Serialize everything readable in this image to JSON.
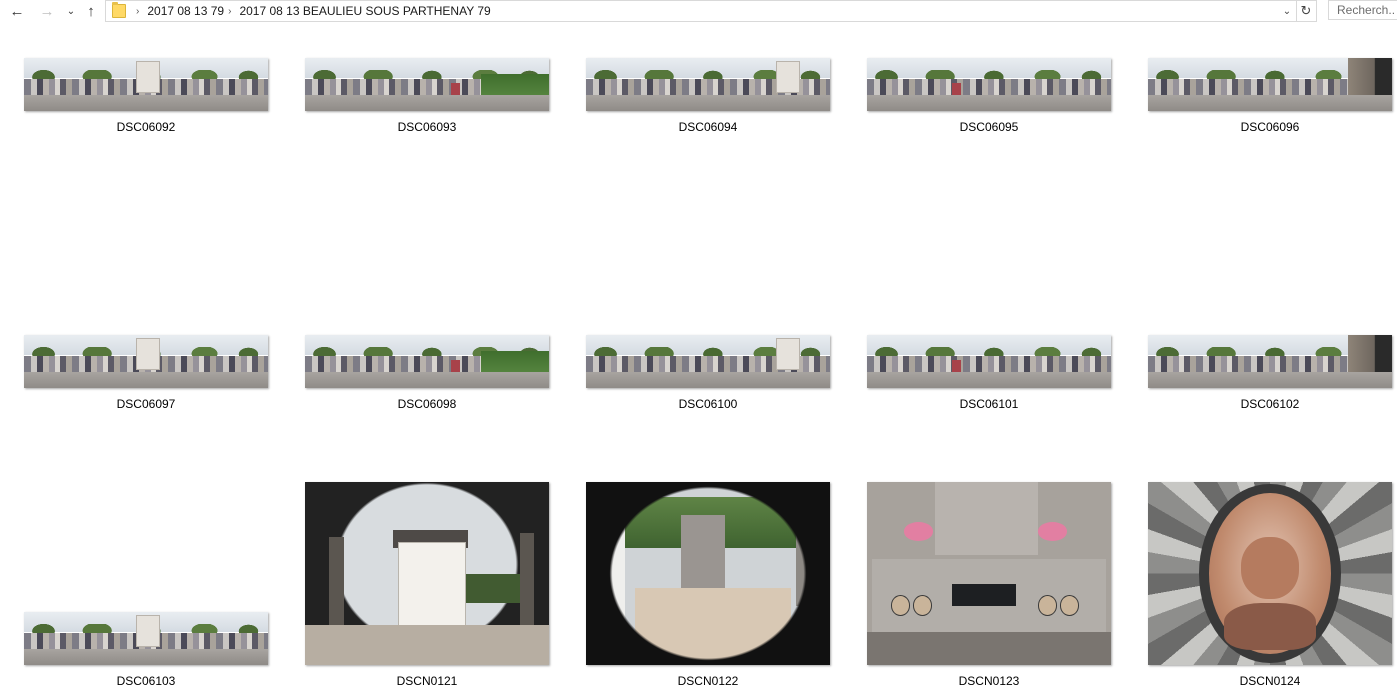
{
  "nav": {
    "back_glyph": "←",
    "forward_glyph": "→",
    "recent_glyph": "⌄",
    "up_glyph": "↑"
  },
  "address_bar": {
    "folder_icon": "folder-icon",
    "separator": "›",
    "breadcrumbs": [
      "2017 08 13 79",
      "2017 08 13 BEAULIEU SOUS PARTHENAY 79"
    ],
    "dropdown_glyph": "⌄",
    "refresh_glyph": "↻"
  },
  "search": {
    "placeholder": "Recherch..."
  },
  "files": [
    {
      "name": "DSC06092",
      "kind": "panorama"
    },
    {
      "name": "DSC06093",
      "kind": "panorama"
    },
    {
      "name": "DSC06094",
      "kind": "panorama"
    },
    {
      "name": "DSC06095",
      "kind": "panorama"
    },
    {
      "name": "DSC06096",
      "kind": "panorama"
    },
    {
      "name": "DSC06097",
      "kind": "panorama"
    },
    {
      "name": "DSC06098",
      "kind": "panorama"
    },
    {
      "name": "DSC06100",
      "kind": "panorama"
    },
    {
      "name": "DSC06101",
      "kind": "panorama"
    },
    {
      "name": "DSC06102",
      "kind": "panorama"
    },
    {
      "name": "DSC06103",
      "kind": "panorama"
    },
    {
      "name": "DSCN0121",
      "kind": "photo-chapel"
    },
    {
      "name": "DSCN0122",
      "kind": "photo-grave"
    },
    {
      "name": "DSCN0123",
      "kind": "photo-plaque"
    },
    {
      "name": "DSCN0124",
      "kind": "photo-portrait"
    }
  ]
}
